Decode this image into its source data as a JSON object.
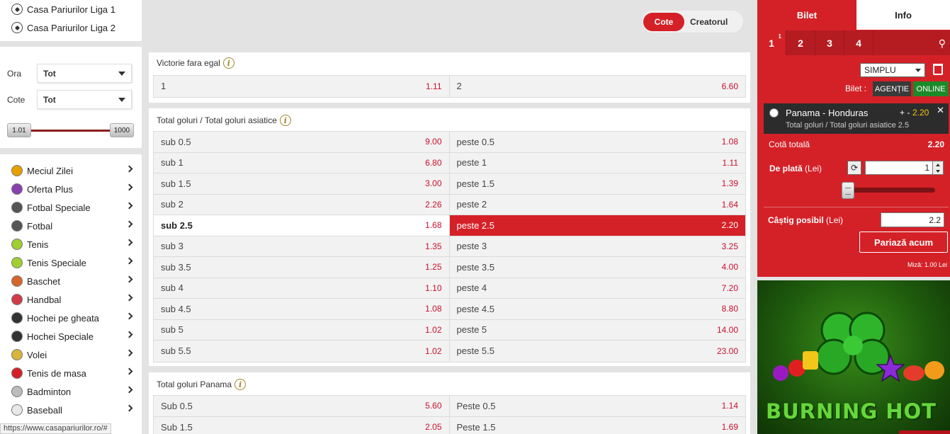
{
  "sidebar": {
    "top_leagues": [
      "Casa Pariurilor Liga 1",
      "Casa Pariurilor Liga 2"
    ],
    "filters": {
      "ora_label": "Ora",
      "ora_value": "Tot",
      "cote_label": "Cote",
      "cote_value": "Tot",
      "range_min": "1.01",
      "range_max": "1000"
    },
    "sports": [
      {
        "label": "Meciul Zilei",
        "icon": "percent-badge-icon",
        "color": "#e6a100"
      },
      {
        "label": "Oferta Plus",
        "icon": "plus-offer-icon",
        "color": "#8a3fb0"
      },
      {
        "label": "Fotbal Speciale",
        "icon": "football-icon",
        "color": "#555555"
      },
      {
        "label": "Fotbal",
        "icon": "football-icon",
        "color": "#555555"
      },
      {
        "label": "Tenis",
        "icon": "tennis-ball-icon",
        "color": "#9fcf30"
      },
      {
        "label": "Tenis Speciale",
        "icon": "tennis-ball-icon",
        "color": "#9fcf30"
      },
      {
        "label": "Baschet",
        "icon": "basketball-icon",
        "color": "#d5662a"
      },
      {
        "label": "Handbal",
        "icon": "handball-icon",
        "color": "#d03a4a"
      },
      {
        "label": "Hochei pe gheata",
        "icon": "hockey-puck-icon",
        "color": "#333333"
      },
      {
        "label": "Hochei Speciale",
        "icon": "hockey-puck-icon",
        "color": "#333333"
      },
      {
        "label": "Volei",
        "icon": "volleyball-icon",
        "color": "#d8b43a"
      },
      {
        "label": "Tenis de masa",
        "icon": "table-tennis-icon",
        "color": "#d42127"
      },
      {
        "label": "Badminton",
        "icon": "shuttlecock-icon",
        "color": "#bbbbbb"
      },
      {
        "label": "Baseball",
        "icon": "baseball-icon",
        "color": "#e8e8e8"
      }
    ],
    "status_url": "https://www.casapariurilor.ro/#"
  },
  "view_toggle": {
    "active": "Cote",
    "inactive": "Creatorul"
  },
  "markets": {
    "victorie": {
      "title": "Victorie fara egal",
      "rows": [
        [
          {
            "l": "1",
            "o": "1.11"
          },
          {
            "l": "2",
            "o": "6.60"
          }
        ]
      ]
    },
    "total_goluri": {
      "title": "Total goluri / Total goluri asiatice",
      "rows": [
        [
          {
            "l": "sub 0.5",
            "o": "9.00"
          },
          {
            "l": "peste 0.5",
            "o": "1.08"
          }
        ],
        [
          {
            "l": "sub 1",
            "o": "6.80"
          },
          {
            "l": "peste 1",
            "o": "1.11"
          }
        ],
        [
          {
            "l": "sub 1.5",
            "o": "3.00"
          },
          {
            "l": "peste 1.5",
            "o": "1.39"
          }
        ],
        [
          {
            "l": "sub 2",
            "o": "2.26"
          },
          {
            "l": "peste 2",
            "o": "1.64"
          }
        ],
        [
          {
            "l": "sub 2.5",
            "o": "1.68"
          },
          {
            "l": "peste 2.5",
            "o": "2.20"
          }
        ],
        [
          {
            "l": "sub 3",
            "o": "1.35"
          },
          {
            "l": "peste 3",
            "o": "3.25"
          }
        ],
        [
          {
            "l": "sub 3.5",
            "o": "1.25"
          },
          {
            "l": "peste 3.5",
            "o": "4.00"
          }
        ],
        [
          {
            "l": "sub 4",
            "o": "1.10"
          },
          {
            "l": "peste 4",
            "o": "7.20"
          }
        ],
        [
          {
            "l": "sub 4.5",
            "o": "1.08"
          },
          {
            "l": "peste 4.5",
            "o": "8.80"
          }
        ],
        [
          {
            "l": "sub 5",
            "o": "1.02"
          },
          {
            "l": "peste 5",
            "o": "14.00"
          }
        ],
        [
          {
            "l": "sub 5.5",
            "o": "1.02"
          },
          {
            "l": "peste 5.5",
            "o": "23.00"
          }
        ]
      ]
    },
    "total_panama": {
      "title": "Total goluri Panama",
      "rows": [
        [
          {
            "l": "Sub 0.5",
            "o": "5.60"
          },
          {
            "l": "Peste 0.5",
            "o": "1.14"
          }
        ],
        [
          {
            "l": "Sub 1.5",
            "o": "2.05"
          },
          {
            "l": "Peste 1.5",
            "o": "1.69"
          }
        ]
      ]
    }
  },
  "betslip": {
    "tab_bilet": "Bilet",
    "tab_info": "Info",
    "slips": [
      "1",
      "2",
      "3",
      "4"
    ],
    "slip1_count": "1",
    "type": "SIMPLU",
    "bilet_label": "Bilet :",
    "btn_agentie": "AGENȚIE",
    "btn_online": "ONLINE",
    "selection": {
      "match": "Panama - Honduras",
      "sign": "+ -",
      "odd": "2.20",
      "market": "Total goluri / Total goluri asiatice 2.5"
    },
    "cota_label": "Cotă totală",
    "cota_value": "2.20",
    "plata_label": "De plată",
    "plata_unit": "(Lei)",
    "stake_value": "1",
    "castig_label": "Câștig posibil",
    "castig_unit": "(Lei)",
    "castig_value": "2.2",
    "button": "Pariază acum",
    "min_stake": "Miză: 1.00 Lei"
  },
  "ad": {
    "text": "BURNING HOT"
  },
  "colors": {
    "brand_red": "#d42127",
    "odd_red": "#c8102e",
    "online_green": "#1d8a2a"
  }
}
